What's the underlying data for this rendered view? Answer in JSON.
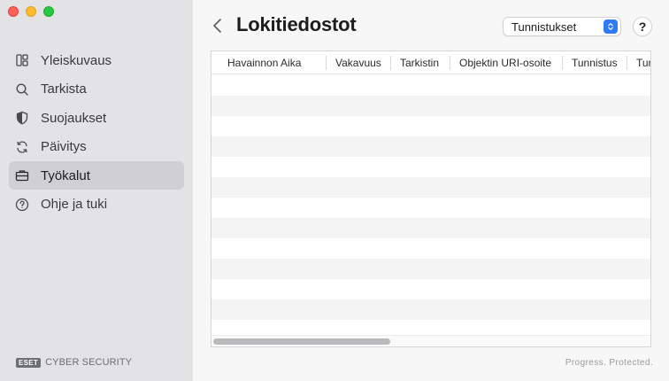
{
  "sidebar": {
    "items": [
      {
        "label": "Yleiskuvaus",
        "icon": "overview-icon",
        "active": false
      },
      {
        "label": "Tarkista",
        "icon": "search-icon",
        "active": false
      },
      {
        "label": "Suojaukset",
        "icon": "shield-icon",
        "active": false
      },
      {
        "label": "Päivitys",
        "icon": "refresh-icon",
        "active": false
      },
      {
        "label": "Työkalut",
        "icon": "briefcase-icon",
        "active": true
      },
      {
        "label": "Ohje ja tuki",
        "icon": "help-circle-icon",
        "active": false
      }
    ],
    "brand": {
      "logo": "eset",
      "text": "CYBER SECURITY"
    }
  },
  "header": {
    "title": "Lokitiedostot",
    "log_type_select": "Tunnistukset",
    "help_label": "?"
  },
  "table": {
    "columns": [
      "Havainnon Aika",
      "Vakavuus",
      "Tarkistin",
      "Objektin URI-osoite",
      "Tunnistus",
      "Tun"
    ],
    "rows": []
  },
  "footer": {
    "tagline": "Progress. Protected."
  },
  "colors": {
    "accent": "#2f7bf6",
    "sidebar_bg": "#e3e3e5",
    "active_item_bg": "#d0d0d3"
  }
}
